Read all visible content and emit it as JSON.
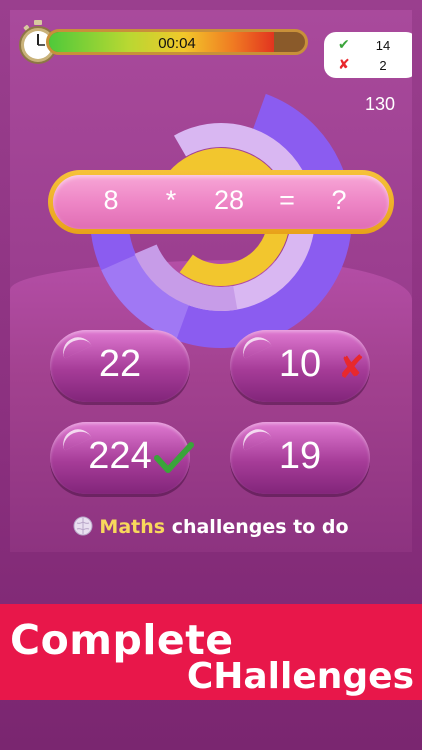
{
  "timer": {
    "label": "00:04",
    "fill_fraction": 0.88
  },
  "score": {
    "correct": "14",
    "wrong": "2",
    "correct_icon": "check-icon",
    "wrong_icon": "cross-icon"
  },
  "points": "130",
  "question": {
    "left": "8",
    "operator": "*",
    "right": "28",
    "equals": "=",
    "unknown": "?"
  },
  "answers": [
    {
      "value": "22",
      "state": "none"
    },
    {
      "value": "10",
      "state": "wrong"
    },
    {
      "value": "224",
      "state": "correct"
    },
    {
      "value": "19",
      "state": "none"
    }
  ],
  "footer": {
    "icon": "brain-icon",
    "highlight": "Maths",
    "rest": " challenges to do"
  },
  "banner": {
    "line1": "Complete",
    "line2": "CHallenges"
  },
  "colors": {
    "correct": "#3aa43a",
    "wrong": "#e8282d",
    "banner": "#e8174a",
    "accent": "#f8d85c"
  }
}
